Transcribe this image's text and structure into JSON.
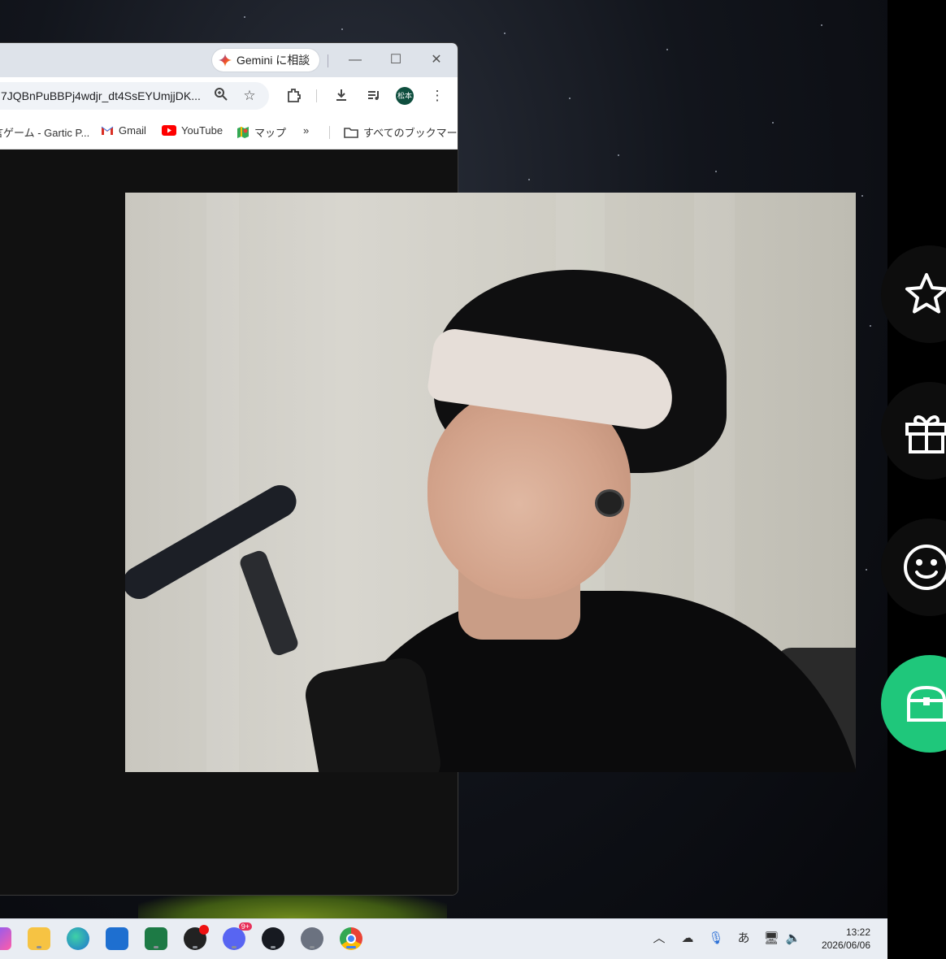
{
  "browser": {
    "gemini_label": "Gemini に相談",
    "url": "7JQBnPuBBPj4wdjr_dt4SsEYUmjjDK...",
    "profile_label": "松本",
    "bookmarks": [
      {
        "label": "言ゲーム - Gartic P..."
      },
      {
        "label": "Gmail"
      },
      {
        "label": "YouTube"
      },
      {
        "label": "マップ"
      }
    ],
    "overflow_label": "»",
    "all_bookmarks_label": "すべてのブックマーク"
  },
  "side_panel": {
    "buttons": [
      {
        "icon": "star-icon"
      },
      {
        "icon": "gift-icon"
      },
      {
        "icon": "smiley-icon"
      },
      {
        "icon": "treasure-chest-icon",
        "active": true
      }
    ],
    "accent_color": "#1fc77b"
  },
  "taskbar": {
    "apps": [
      "copilot-icon",
      "file-explorer-icon",
      "edge-icon",
      "store-icon",
      "excel-icon",
      "obs-icon",
      "discord-icon",
      "steam-icon",
      "settings-icon",
      "chrome-icon"
    ],
    "discord_badge": "9+",
    "ime_label": "あ",
    "time": "13:22",
    "date": "2026/06/06"
  }
}
